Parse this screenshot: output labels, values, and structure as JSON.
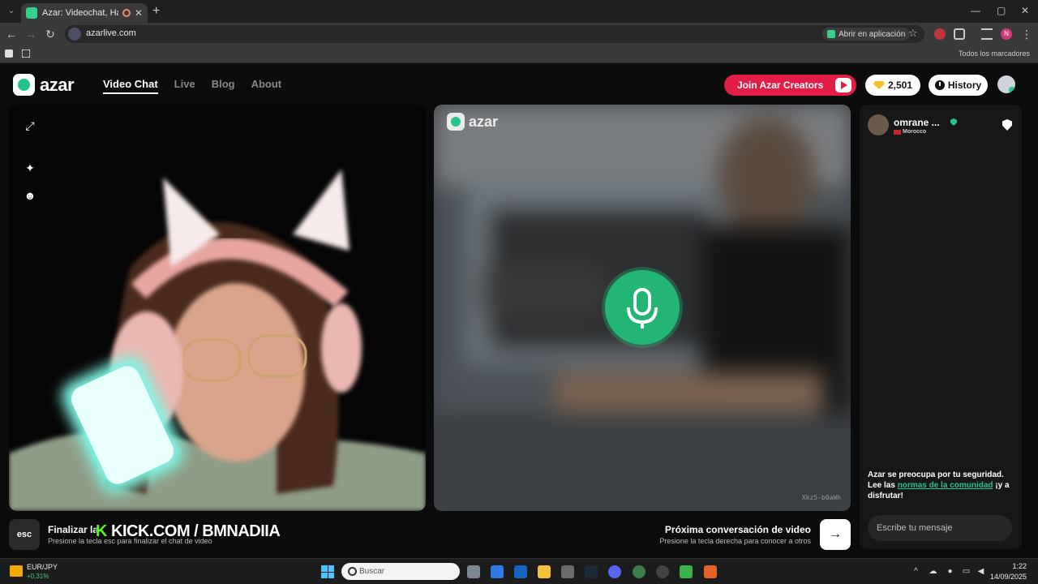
{
  "browser": {
    "tab_title": "Azar: Videochat, Haz nuevo",
    "url": "azarlive.com",
    "open_in_app": "Abrir en aplicación",
    "bookmarks_all": "Todos los marcadores",
    "profile_initial": "N"
  },
  "header": {
    "logo_text": "azar",
    "nav": [
      "Video Chat",
      "Live",
      "Blog",
      "About"
    ],
    "creators_label": "Join Azar Creators",
    "gems_count": "2,501",
    "history_label": "History"
  },
  "remote_video": {
    "watermark": "azar",
    "code": "Xkz5-b0aWh"
  },
  "controls": {
    "esc_key": "esc",
    "end_title": "Finalizar la",
    "end_sub": "Presione la tecla esc para finalizar el chat de video",
    "overlay_k": "K",
    "overlay_text": "KICK.COM / BMNADIIA",
    "next_title": "Próxima conversación de video",
    "next_sub": "Presione la tecla derecha para conocer a otros"
  },
  "chat": {
    "partner_name": "omrane ...",
    "partner_country": "Morocco",
    "safety_pre": "Azar se preocupa por tu seguridad. Lee las ",
    "safety_link": "normas de la comunidad",
    "safety_post": " ¡y a disfrutar!",
    "input_placeholder": "Escribe tu mensaje"
  },
  "taskbar": {
    "ticker_name": "EUR/JPY",
    "ticker_change": "+0,31%",
    "search_placeholder": "Buscar",
    "time": "1:22",
    "date": "14/09/2025"
  },
  "colors": {
    "brand_green": "#23c48a",
    "creators_red": "#e11d48",
    "mic_green": "#22b573"
  }
}
